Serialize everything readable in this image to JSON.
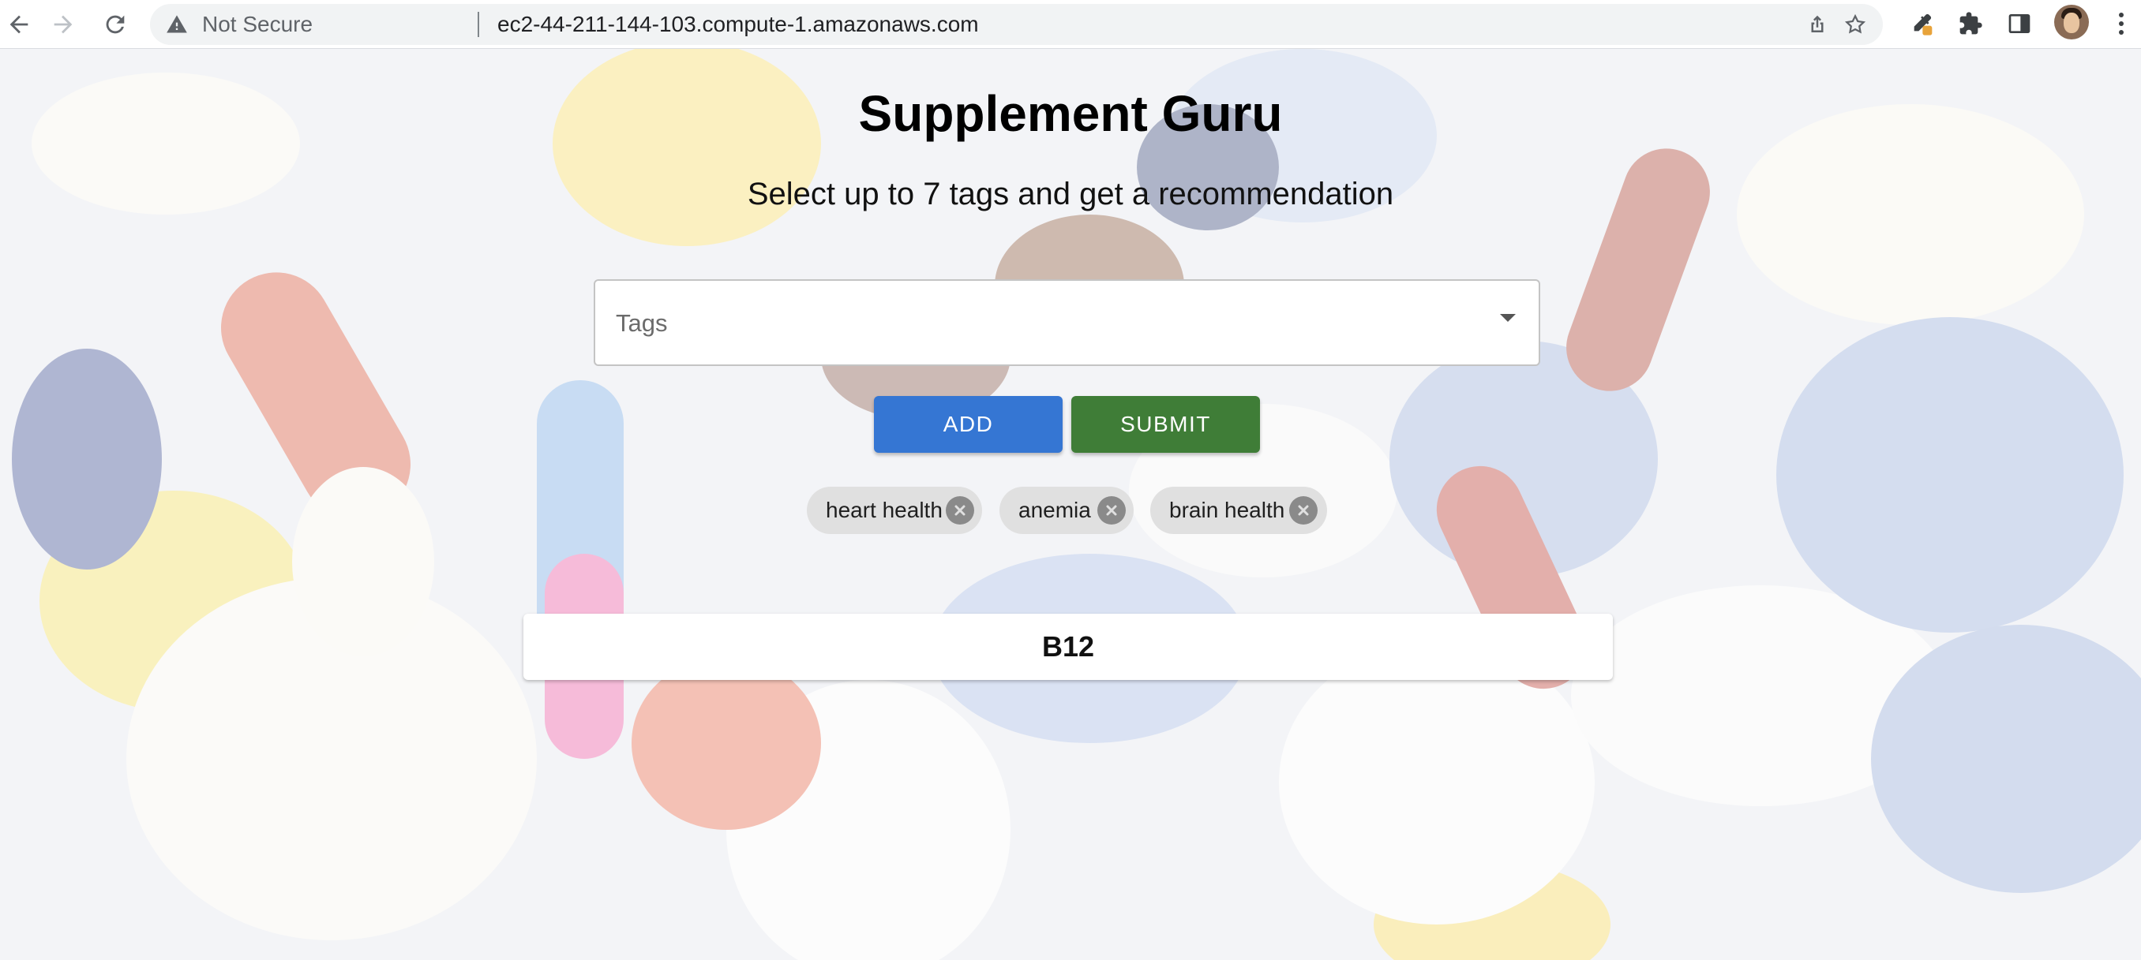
{
  "browser": {
    "security_label": "Not Secure",
    "url": "ec2-44-211-144-103.compute-1.amazonaws.com"
  },
  "app": {
    "title": "Supplement Guru",
    "subtitle": "Select up to 7 tags and get a recommendation",
    "tags_placeholder": "Tags",
    "add_label": "ADD",
    "submit_label": "SUBMIT",
    "selected_tags": [
      "heart health",
      "anemia",
      "brain health"
    ],
    "recommendation": "B12"
  },
  "colors": {
    "add_button": "#3576d3",
    "submit_button": "#3f7d37",
    "chip_background": "#e0e0e0"
  }
}
